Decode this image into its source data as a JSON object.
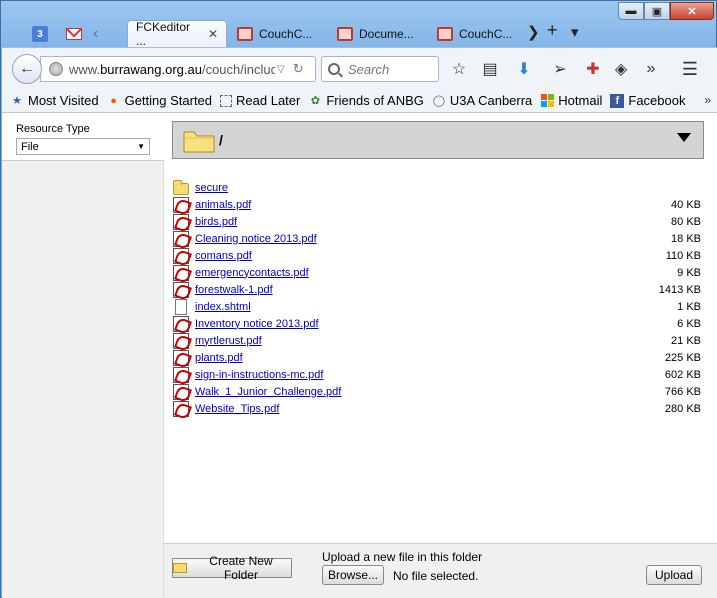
{
  "window": {
    "controls": {
      "minimize": "▬",
      "maximize": "▣",
      "close": "✕"
    }
  },
  "tabs": {
    "pinned": [
      {
        "icon": "google-calendar-icon",
        "text": "3"
      },
      {
        "icon": "gmail-icon"
      }
    ],
    "items": [
      {
        "label": "FCKeditor ...",
        "active": true
      },
      {
        "label": "CouchC...",
        "active": false
      },
      {
        "label": "Docume...",
        "active": false
      },
      {
        "label": "CouchC...",
        "active": false
      }
    ],
    "new_tab": "+",
    "scroll_right": "❯",
    "list_all": "▾"
  },
  "navbar": {
    "url_prefix": "www.",
    "url_host": "burrawang.org.au",
    "url_path": "/couch/include",
    "search_placeholder": "Search"
  },
  "bookmarks": [
    {
      "label": "Most Visited",
      "icon": "bookmark-star-icon"
    },
    {
      "label": "Getting Started",
      "icon": "firefox-icon"
    },
    {
      "label": "Read Later",
      "icon": "dashed-box-icon"
    },
    {
      "label": "Friends of ANBG",
      "icon": "plant-icon"
    },
    {
      "label": "U3A Canberra",
      "icon": "globe-icon"
    },
    {
      "label": "Hotmail",
      "icon": "windows-icon"
    },
    {
      "label": "Facebook",
      "icon": "facebook-icon"
    }
  ],
  "resource_type": {
    "label": "Resource Type",
    "selected": "File"
  },
  "current_folder": "/",
  "files": [
    {
      "name": "secure",
      "type": "folder",
      "size": ""
    },
    {
      "name": "animals.pdf",
      "type": "pdf",
      "size": "40 KB"
    },
    {
      "name": "birds.pdf",
      "type": "pdf",
      "size": "80 KB"
    },
    {
      "name": "Cleaning notice 2013.pdf",
      "type": "pdf",
      "size": "18 KB"
    },
    {
      "name": "comans.pdf",
      "type": "pdf",
      "size": "110 KB"
    },
    {
      "name": "emergencycontacts.pdf",
      "type": "pdf",
      "size": "9 KB"
    },
    {
      "name": "forestwalk-1.pdf",
      "type": "pdf",
      "size": "1413 KB"
    },
    {
      "name": "index.shtml",
      "type": "doc",
      "size": "1 KB"
    },
    {
      "name": "Inventory notice 2013.pdf",
      "type": "pdf",
      "size": "6 KB"
    },
    {
      "name": "myrtlerust.pdf",
      "type": "pdf",
      "size": "21 KB"
    },
    {
      "name": "plants.pdf",
      "type": "pdf",
      "size": "225 KB"
    },
    {
      "name": "sign-in-instructions-mc.pdf",
      "type": "pdf",
      "size": "602 KB"
    },
    {
      "name": "Walk_1_Junior_Challenge.pdf",
      "type": "pdf",
      "size": "766 KB"
    },
    {
      "name": "Website_Tips.pdf",
      "type": "pdf",
      "size": "280 KB"
    }
  ],
  "bottom": {
    "create_folder": "Create New Folder",
    "upload_label": "Upload a new file in this folder",
    "browse": "Browse...",
    "no_file": "No file selected.",
    "upload": "Upload"
  }
}
